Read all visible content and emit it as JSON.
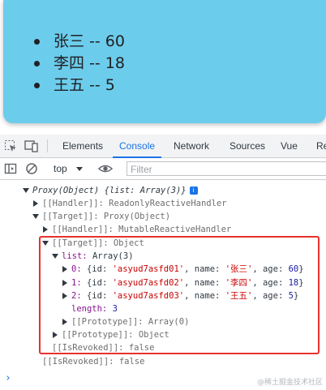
{
  "app": {
    "items": [
      "张三 -- 60",
      "李四 -- 18",
      "王五 -- 5"
    ]
  },
  "devtools": {
    "tabs": [
      "Elements",
      "Console",
      "Network",
      "Sources",
      "Vue",
      "Re"
    ],
    "active_tab": "Console",
    "context": "top",
    "filter_placeholder": "Filter"
  },
  "console": {
    "root_label": "Proxy(Object)",
    "root_preview": "{list: Array(3)}",
    "info_badge": "i",
    "handler1": "[[Handler]]: ReadonlyReactiveHandler",
    "target1": "[[Target]]: Proxy(Object)",
    "handler2": "[[Handler]]: MutableReactiveHandler",
    "target2": "[[Target]]: Object",
    "list_key": "list:",
    "list_val": "Array(3)",
    "items": [
      {
        "idx": "0:",
        "id": "'asyud7asfd01'",
        "name": "'张三'",
        "age": "60"
      },
      {
        "idx": "1:",
        "id": "'asyud7asfd02'",
        "name": "'李四'",
        "age": "18"
      },
      {
        "idx": "2:",
        "id": "'asyud7asfd03'",
        "name": "'王五'",
        "age": "5"
      }
    ],
    "length_key": "length:",
    "length_val": "3",
    "proto_array": "[[Prototype]]: Array(0)",
    "proto_obj": "[[Prototype]]: Object",
    "isrevoked_inner": "[[IsRevoked]]: false",
    "isrevoked_outer": "[[IsRevoked]]: false"
  },
  "watermark": "@稀土掘金技术社区",
  "colors": {
    "accent": "#1a73e8",
    "highlight_box": "#e8312a",
    "app_bg": "#6cccec"
  }
}
